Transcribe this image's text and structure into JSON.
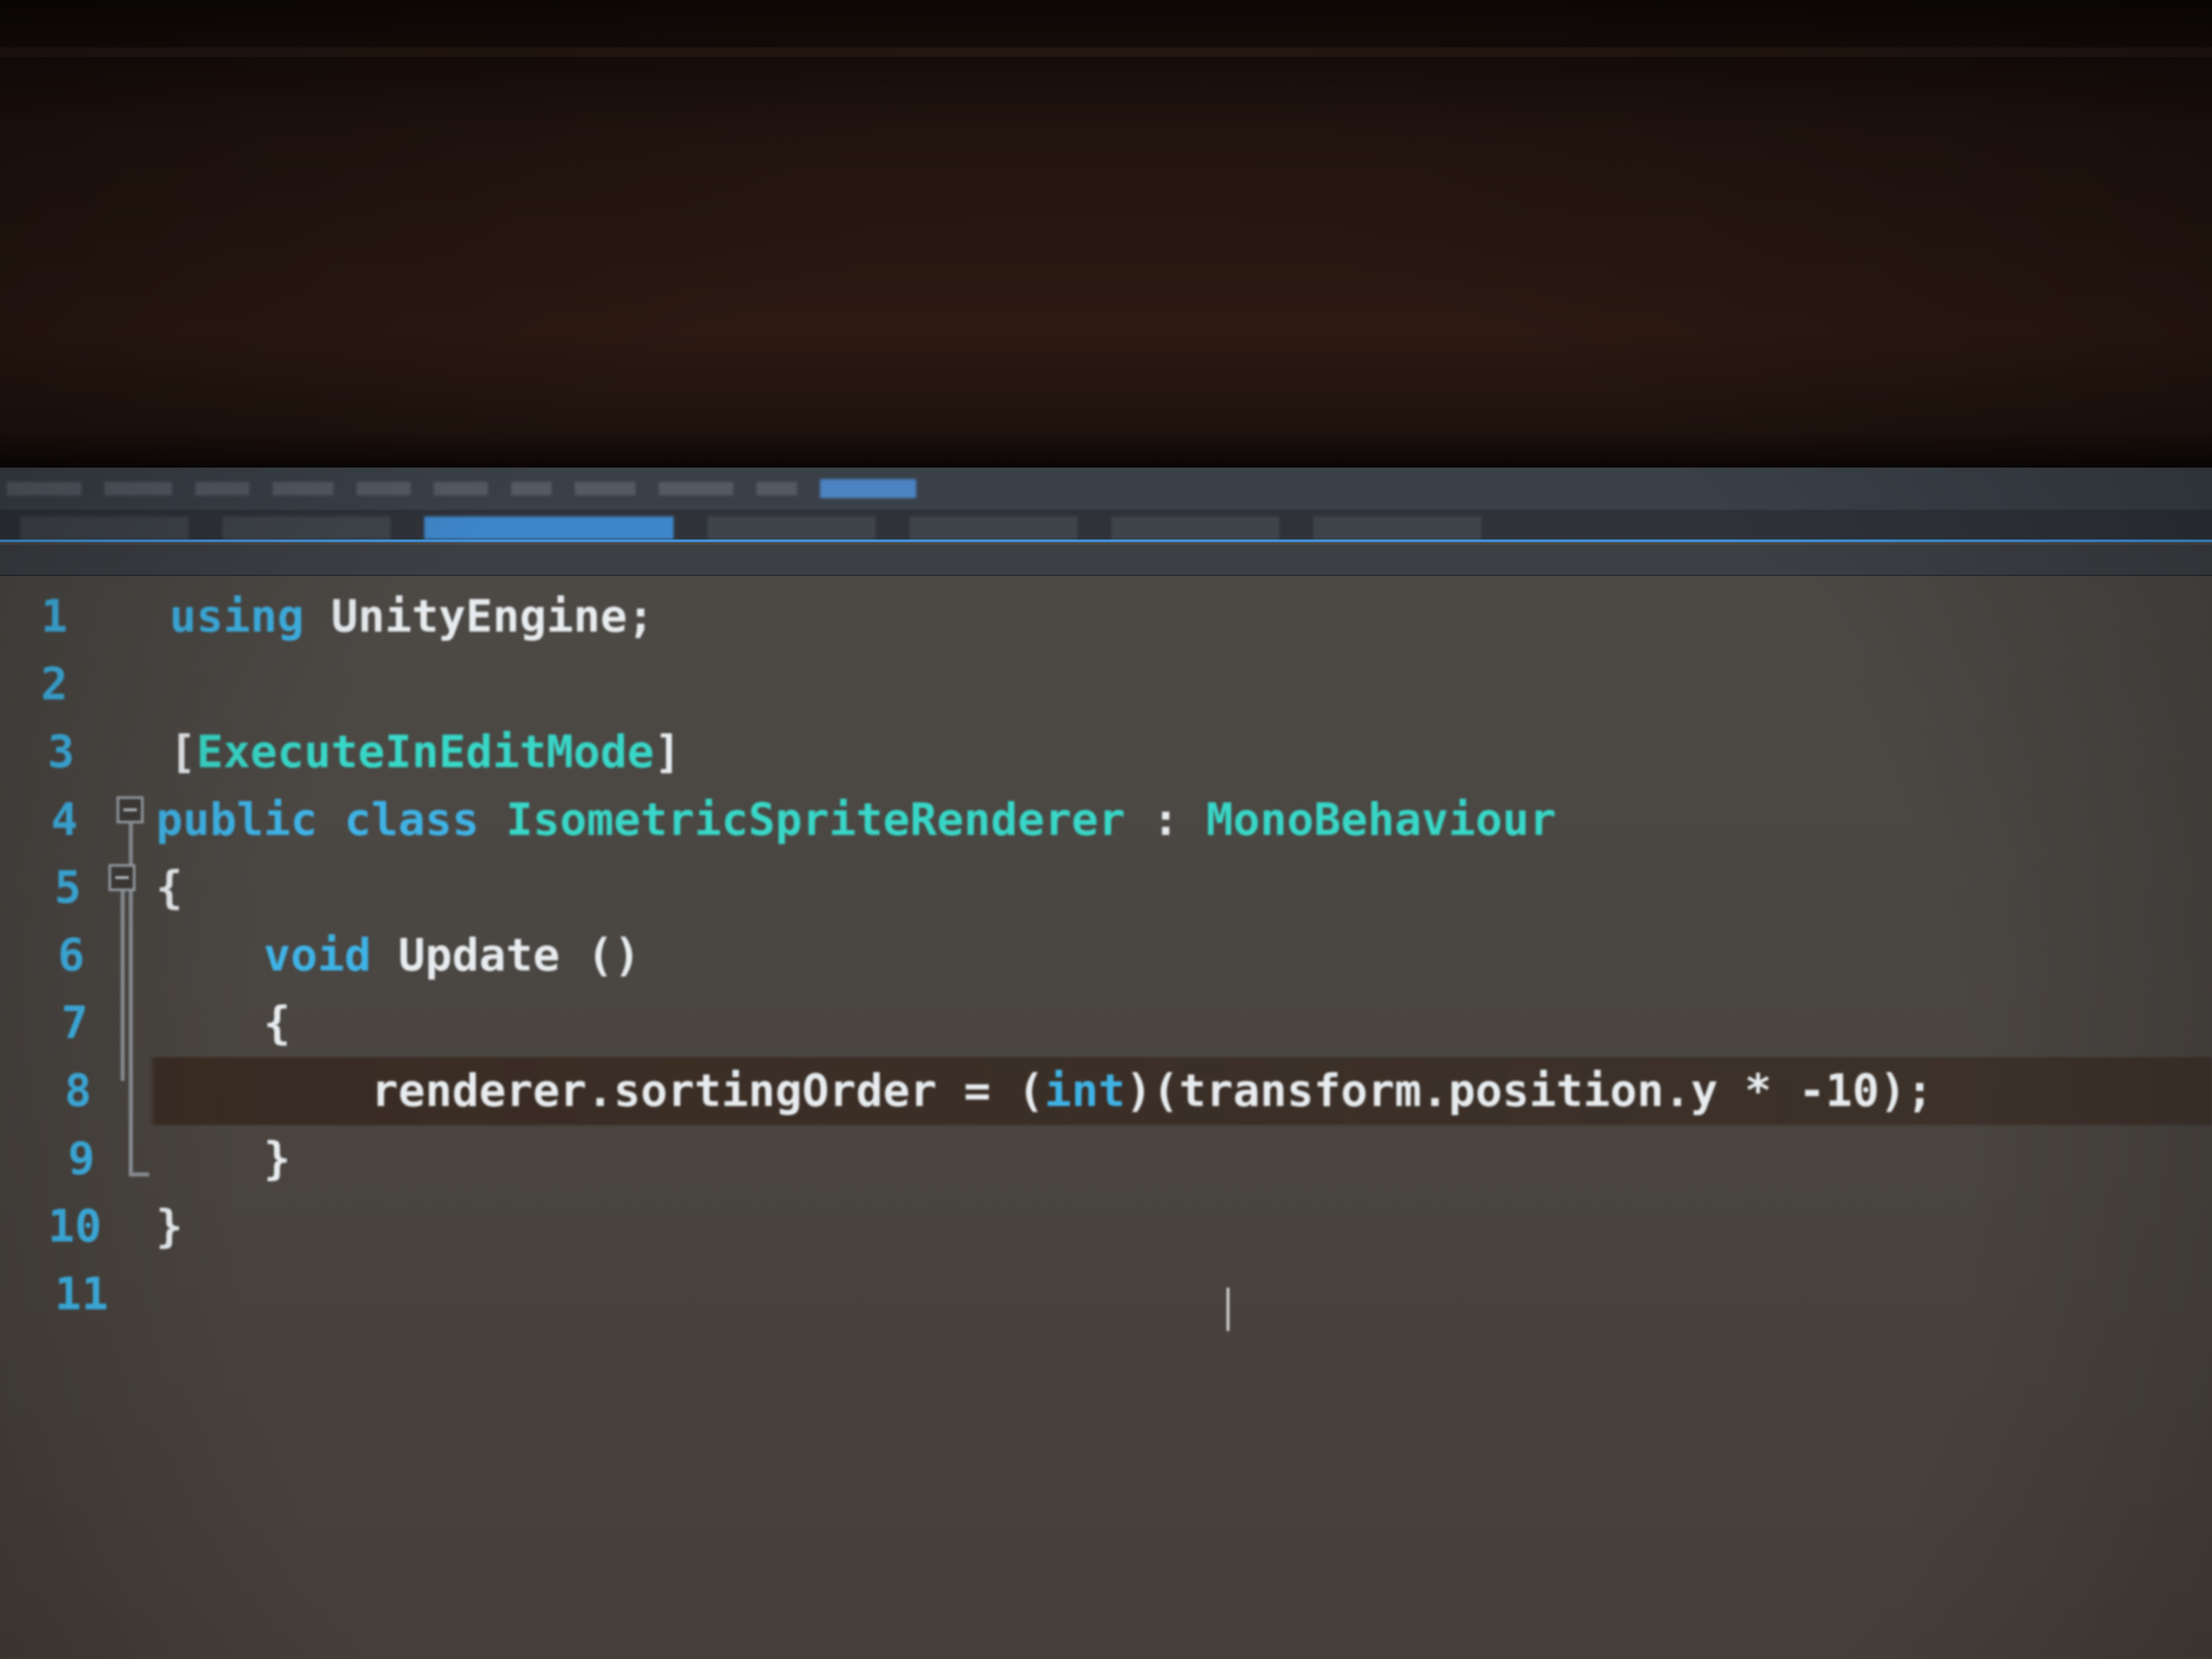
{
  "window": {
    "menu_items": [
      "",
      "",
      "",
      "",
      "",
      "",
      "",
      "",
      "",
      "",
      ""
    ],
    "active_menu_label": "",
    "tabs": [
      "",
      "",
      "",
      "",
      "",
      "",
      ""
    ],
    "active_tab_index": 2,
    "nav_type": "",
    "nav_member": ""
  },
  "editor": {
    "language": "C#",
    "current_line": 8,
    "lines": [
      {
        "n": "1",
        "tokens": [
          {
            "t": "using",
            "c": "kw"
          },
          {
            "t": " ",
            "c": "pn"
          },
          {
            "t": "UnityEngine",
            "c": "nm"
          },
          {
            "t": ";",
            "c": "pn"
          }
        ]
      },
      {
        "n": "2",
        "tokens": []
      },
      {
        "n": "3",
        "tokens": [
          {
            "t": "[",
            "c": "pn"
          },
          {
            "t": "ExecuteInEditMode",
            "c": "at"
          },
          {
            "t": "]",
            "c": "pn"
          }
        ]
      },
      {
        "n": "4",
        "tokens": [
          {
            "t": "public",
            "c": "kw"
          },
          {
            "t": " ",
            "c": "pn"
          },
          {
            "t": "class",
            "c": "kw"
          },
          {
            "t": " ",
            "c": "pn"
          },
          {
            "t": "IsometricSpriteRenderer",
            "c": "ty"
          },
          {
            "t": " : ",
            "c": "pn"
          },
          {
            "t": "MonoBehaviour",
            "c": "ty"
          }
        ]
      },
      {
        "n": "5",
        "tokens": [
          {
            "t": "{",
            "c": "pn"
          }
        ]
      },
      {
        "n": "6",
        "tokens": [
          {
            "t": "    ",
            "c": "pn"
          },
          {
            "t": "void",
            "c": "kw"
          },
          {
            "t": " ",
            "c": "pn"
          },
          {
            "t": "Update",
            "c": "nm"
          },
          {
            "t": " ()",
            "c": "pn"
          }
        ]
      },
      {
        "n": "7",
        "tokens": [
          {
            "t": "    ",
            "c": "pn"
          },
          {
            "t": "{",
            "c": "pn"
          }
        ]
      },
      {
        "n": "8",
        "tokens": [
          {
            "t": "        ",
            "c": "pn"
          },
          {
            "t": "renderer.sortingOrder = (",
            "c": "nm"
          },
          {
            "t": "int",
            "c": "kw"
          },
          {
            "t": ")(transform.position.y * -10);",
            "c": "nm"
          }
        ]
      },
      {
        "n": "9",
        "tokens": [
          {
            "t": "    ",
            "c": "pn"
          },
          {
            "t": "}",
            "c": "pn"
          }
        ]
      },
      {
        "n": "10",
        "tokens": [
          {
            "t": "}",
            "c": "pn"
          }
        ]
      },
      {
        "n": "11",
        "tokens": []
      }
    ]
  },
  "colors": {
    "keyword": "#3fb3e6",
    "type": "#38d7c7",
    "plain": "#e8ecef",
    "editor_background": "#4a4642",
    "accent": "#3f8fd8"
  }
}
